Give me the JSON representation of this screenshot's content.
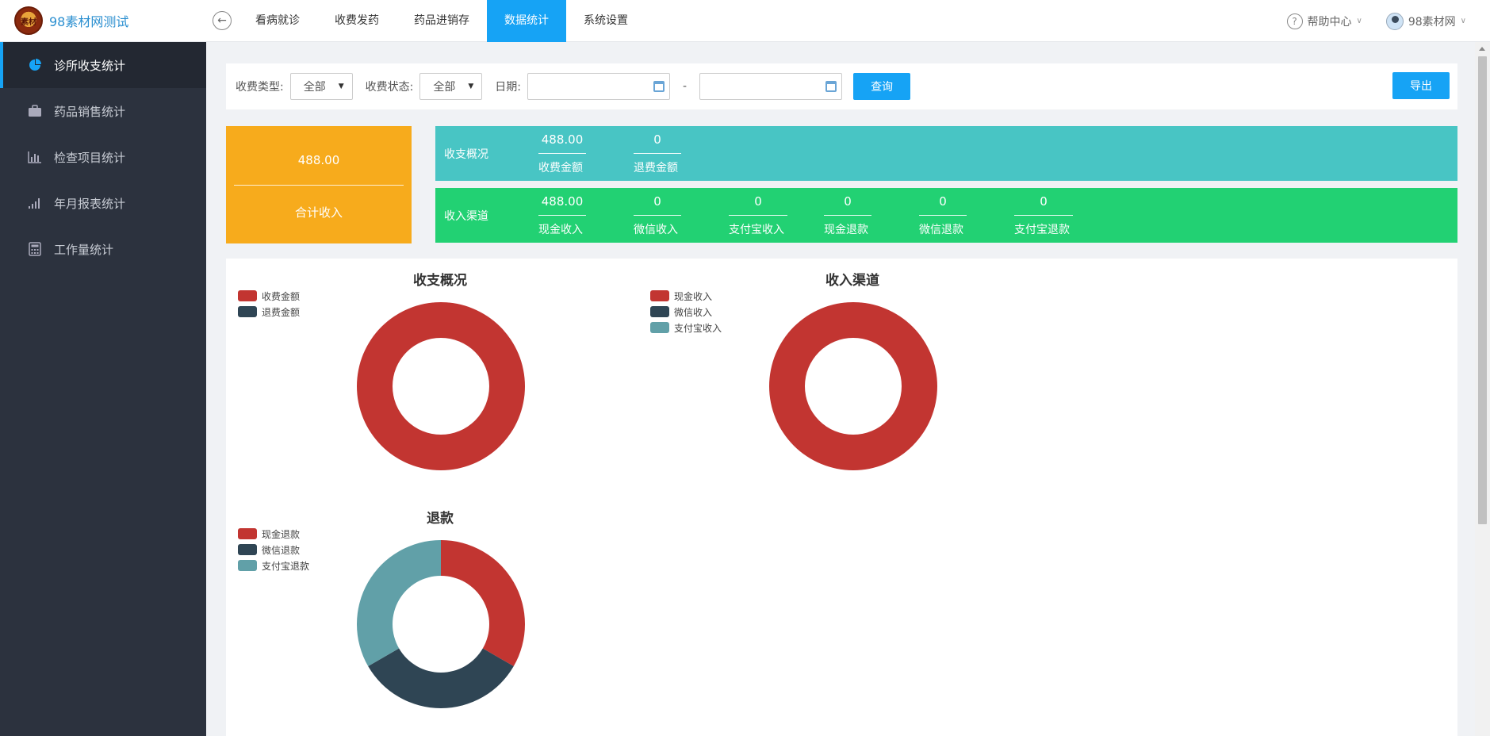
{
  "app": {
    "title": "98素材网测试",
    "logo_text": "素材"
  },
  "nav": {
    "items": [
      {
        "label": "看病就诊",
        "active": false
      },
      {
        "label": "收费发药",
        "active": false
      },
      {
        "label": "药品进销存",
        "active": false
      },
      {
        "label": "数据统计",
        "active": true
      },
      {
        "label": "系统设置",
        "active": false
      }
    ]
  },
  "topright": {
    "help": "帮助中心",
    "user": "98素材网"
  },
  "sidebar": {
    "items": [
      {
        "label": "诊所收支统计",
        "icon": "pie-chart-icon",
        "active": true
      },
      {
        "label": "药品销售统计",
        "icon": "briefcase-icon",
        "active": false
      },
      {
        "label": "检查项目统计",
        "icon": "bar-chart-icon",
        "active": false
      },
      {
        "label": "年月报表统计",
        "icon": "signal-bars-icon",
        "active": false
      },
      {
        "label": "工作量统计",
        "icon": "calculator-icon",
        "active": false
      }
    ]
  },
  "filter": {
    "type_label": "收费类型:",
    "type_value": "全部",
    "status_label": "收费状态:",
    "status_value": "全部",
    "date_label": "日期:",
    "date_separator": "-",
    "query_button": "查询",
    "export_button": "导出"
  },
  "summary": {
    "total_value": "488.00",
    "total_label": "合计收入"
  },
  "overview": {
    "title": "收支概况",
    "stats": [
      {
        "value": "488.00",
        "label": "收费金额"
      },
      {
        "value": "0",
        "label": "退费金额"
      }
    ]
  },
  "channels": {
    "title": "收入渠道",
    "stats": [
      {
        "value": "488.00",
        "label": "现金收入"
      },
      {
        "value": "0",
        "label": "微信收入"
      },
      {
        "value": "0",
        "label": "支付宝收入"
      },
      {
        "value": "0",
        "label": "现金退款"
      },
      {
        "value": "0",
        "label": "微信退款"
      },
      {
        "value": "0",
        "label": "支付宝退款"
      }
    ]
  },
  "colors": {
    "red": "#c23531",
    "navy": "#2f4554",
    "teal": "#61a0a8",
    "accent": "#16a3f5",
    "orange": "#f7ab1c",
    "teal_band": "#48c5c4",
    "green_band": "#22d173"
  },
  "chart_data": [
    {
      "type": "pie",
      "title": "收支概况",
      "categories": [
        "收费金额",
        "退费金额"
      ],
      "values": [
        488,
        0
      ],
      "colors": [
        "#c23531",
        "#2f4554"
      ]
    },
    {
      "type": "pie",
      "title": "收入渠道",
      "categories": [
        "现金收入",
        "微信收入",
        "支付宝收入"
      ],
      "values": [
        488,
        0,
        0
      ],
      "colors": [
        "#c23531",
        "#2f4554",
        "#61a0a8"
      ]
    },
    {
      "type": "pie",
      "title": "退款",
      "categories": [
        "现金退款",
        "微信退款",
        "支付宝退款"
      ],
      "values": [
        1,
        1,
        1
      ],
      "colors": [
        "#c23531",
        "#2f4554",
        "#61a0a8"
      ]
    }
  ]
}
